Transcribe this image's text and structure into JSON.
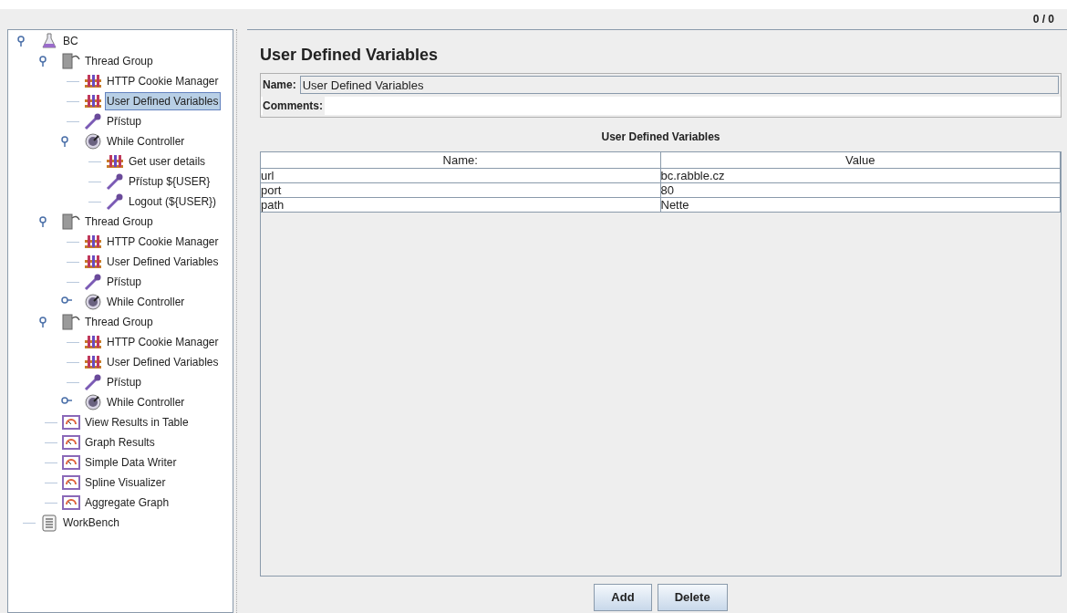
{
  "toolbar": {
    "counter": "0 / 0"
  },
  "tree": [
    {
      "label": "BC",
      "kind": "plan",
      "selected": false,
      "expanded": true,
      "children": [
        {
          "label": "Thread Group",
          "kind": "threads",
          "selected": false,
          "expanded": true,
          "children": [
            {
              "label": "HTTP Cookie Manager",
              "kind": "config",
              "selected": false
            },
            {
              "label": "User Defined Variables",
              "kind": "config",
              "selected": true
            },
            {
              "label": "Přístup",
              "kind": "sampler",
              "selected": false
            },
            {
              "label": "While Controller",
              "kind": "controller",
              "selected": false,
              "expanded": true,
              "children": [
                {
                  "label": "Get user details",
                  "kind": "config",
                  "selected": false
                },
                {
                  "label": "Přístup ${USER}",
                  "kind": "sampler",
                  "selected": false
                },
                {
                  "label": "Logout (${USER})",
                  "kind": "sampler",
                  "selected": false
                }
              ]
            }
          ]
        },
        {
          "label": "Thread Group",
          "kind": "threads",
          "selected": false,
          "expanded": true,
          "children": [
            {
              "label": "HTTP Cookie Manager",
              "kind": "config",
              "selected": false
            },
            {
              "label": "User Defined Variables",
              "kind": "config",
              "selected": false
            },
            {
              "label": "Přístup",
              "kind": "sampler",
              "selected": false
            },
            {
              "label": "While Controller",
              "kind": "controller",
              "selected": false,
              "expanded": false
            }
          ]
        },
        {
          "label": "Thread Group",
          "kind": "threads",
          "selected": false,
          "expanded": true,
          "children": [
            {
              "label": "HTTP Cookie Manager",
              "kind": "config",
              "selected": false
            },
            {
              "label": "User Defined Variables",
              "kind": "config",
              "selected": false
            },
            {
              "label": "Přístup",
              "kind": "sampler",
              "selected": false
            },
            {
              "label": "While Controller",
              "kind": "controller",
              "selected": false,
              "expanded": false
            }
          ]
        },
        {
          "label": "View Results in Table",
          "kind": "listener",
          "selected": false
        },
        {
          "label": "Graph Results",
          "kind": "listener",
          "selected": false
        },
        {
          "label": "Simple Data Writer",
          "kind": "listener",
          "selected": false
        },
        {
          "label": "Spline Visualizer",
          "kind": "listener",
          "selected": false
        },
        {
          "label": "Aggregate Graph",
          "kind": "listener",
          "selected": false
        }
      ]
    },
    {
      "label": "WorkBench",
      "kind": "workbench",
      "selected": false
    }
  ],
  "panel": {
    "title": "User Defined Variables",
    "name_label": "Name:",
    "name_value": "User Defined Variables",
    "comments_label": "Comments:",
    "table": {
      "title": "User Defined Variables",
      "columns": [
        "Name:",
        "Value"
      ],
      "rows": [
        [
          "url",
          "bc.rabble.cz"
        ],
        [
          "port",
          "80"
        ],
        [
          "path",
          "Nette"
        ]
      ]
    },
    "buttons": [
      "Add",
      "Delete"
    ]
  }
}
